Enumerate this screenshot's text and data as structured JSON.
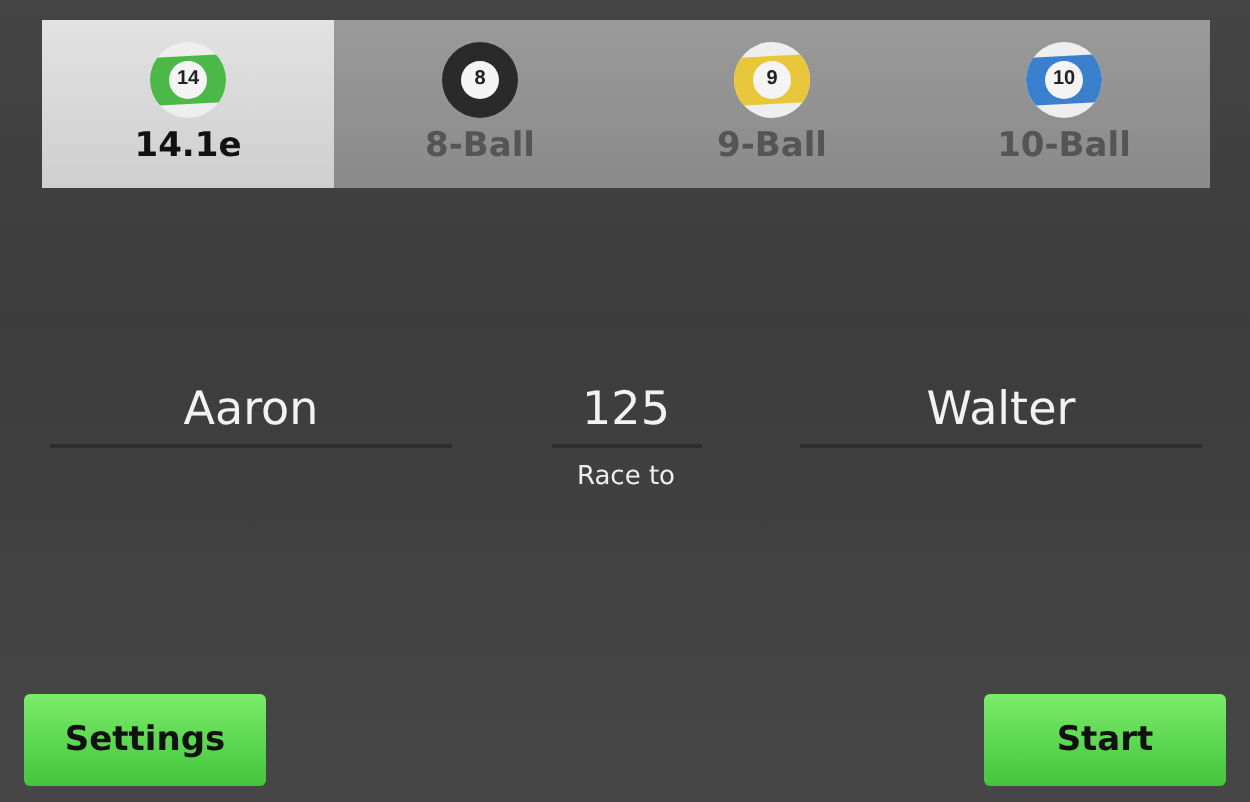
{
  "tabs": [
    {
      "label": "14.1e",
      "selected": true,
      "ball": {
        "number": "14",
        "kind": "striped",
        "color": "#4cb848"
      }
    },
    {
      "label": "8-Ball",
      "selected": false,
      "ball": {
        "number": "8",
        "kind": "solid",
        "color": "#2a2a2a"
      }
    },
    {
      "label": "9-Ball",
      "selected": false,
      "ball": {
        "number": "9",
        "kind": "striped",
        "color": "#e8c83a"
      }
    },
    {
      "label": "10-Ball",
      "selected": false,
      "ball": {
        "number": "10",
        "kind": "striped",
        "color": "#3b80cc"
      }
    }
  ],
  "players": {
    "left": {
      "value": "Aaron"
    },
    "race": {
      "value": "125",
      "caption": "Race to"
    },
    "right": {
      "value": "Walter"
    }
  },
  "buttons": [
    {
      "label": "Settings"
    },
    {
      "label": "Start"
    }
  ]
}
